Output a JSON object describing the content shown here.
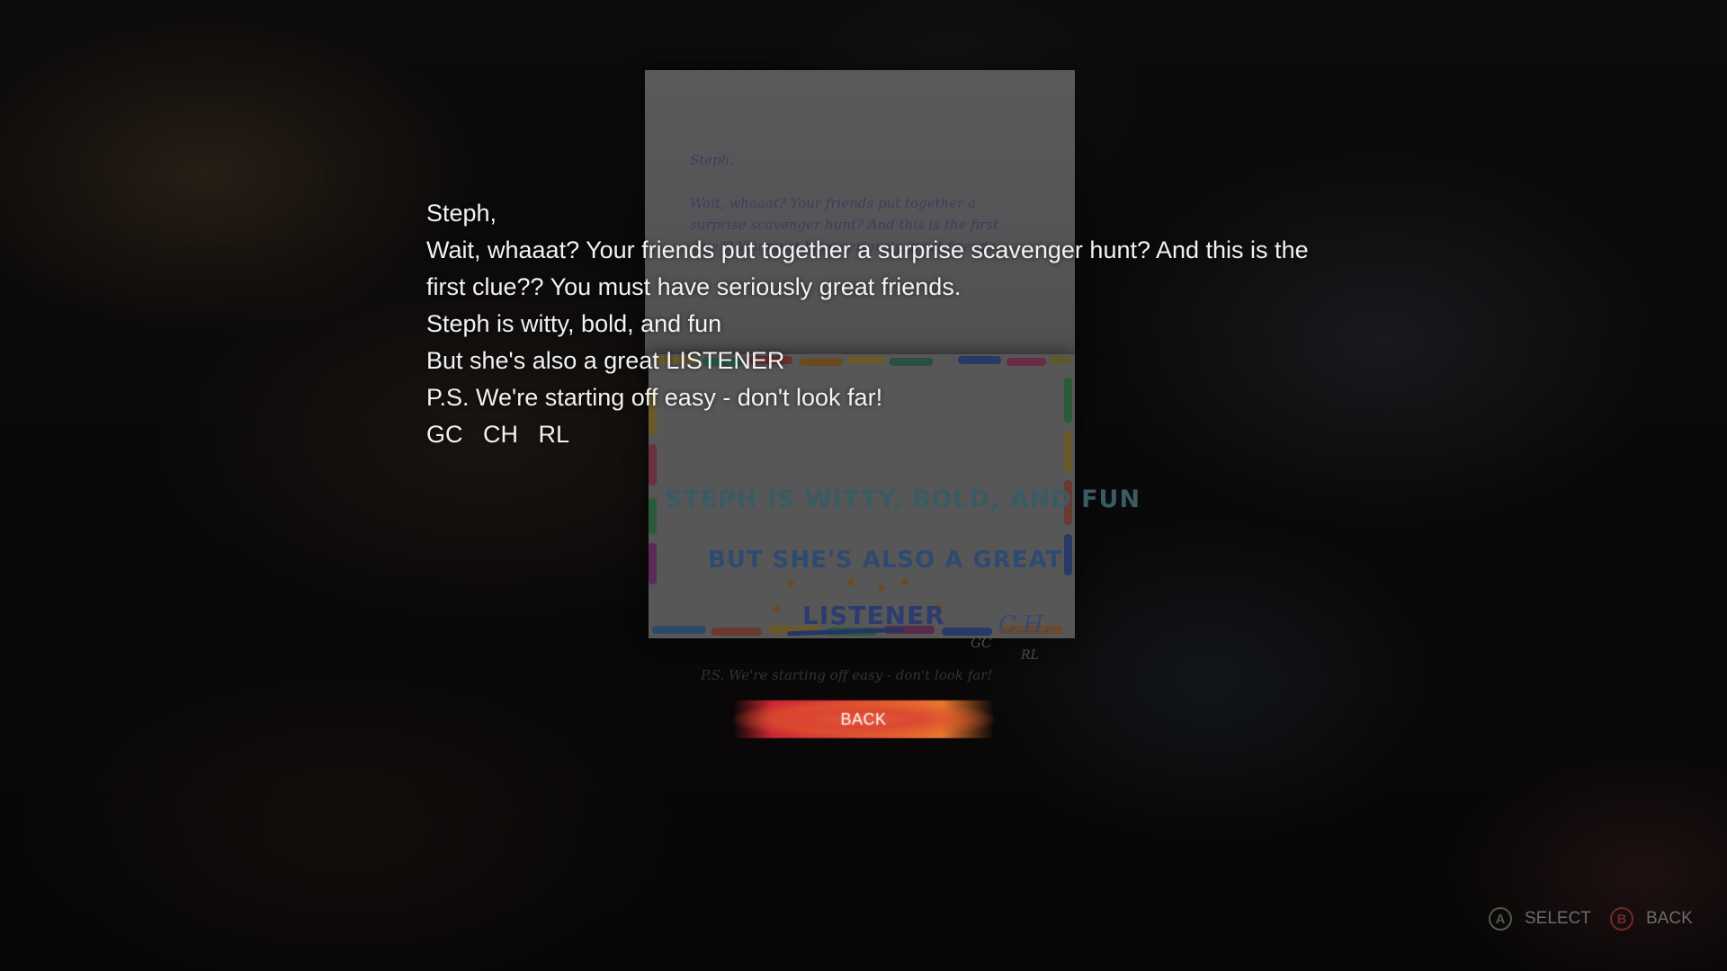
{
  "note": {
    "handwritten_greeting": "Steph,",
    "handwritten_body": "Wait, whaaat? Your friends put together a surprise scavenger hunt? And this is the first clue?? You must have seriously great friends.",
    "crayon_line1": "STEPH IS WITTY, BOLD, AND FUN",
    "crayon_line2": "BUT SHE'S ALSO A GREAT",
    "crayon_line3": "LISTENER",
    "sig_gc": "GC",
    "sig_ch": "C.H.",
    "sig_rl": "RL",
    "handwritten_ps": "P.S. We're starting off easy - don't look far!"
  },
  "transcript": {
    "line1": "Steph,",
    "line2": "Wait, whaaat? Your friends put together a surprise scavenger hunt? And this is the",
    "line3": "first clue?? You must have seriously great friends.",
    "line4": "Steph is witty, bold, and fun",
    "line5": "But she's also a great LISTENER",
    "line6": "P.S. We're starting off easy - don't look far!",
    "line7": "GC   CH   RL"
  },
  "back_button": {
    "label": "BACK"
  },
  "hints": {
    "select_button": "A",
    "select_label": "SELECT",
    "back_button": "B",
    "back_label": "BACK"
  },
  "colors": {
    "button_gradient_start": "#d72a3a",
    "button_gradient_end": "#f09030",
    "hint_text": "#6b6b6b",
    "select_button_color": "#4e5a4e",
    "back_button_color": "#6e2a2a"
  }
}
